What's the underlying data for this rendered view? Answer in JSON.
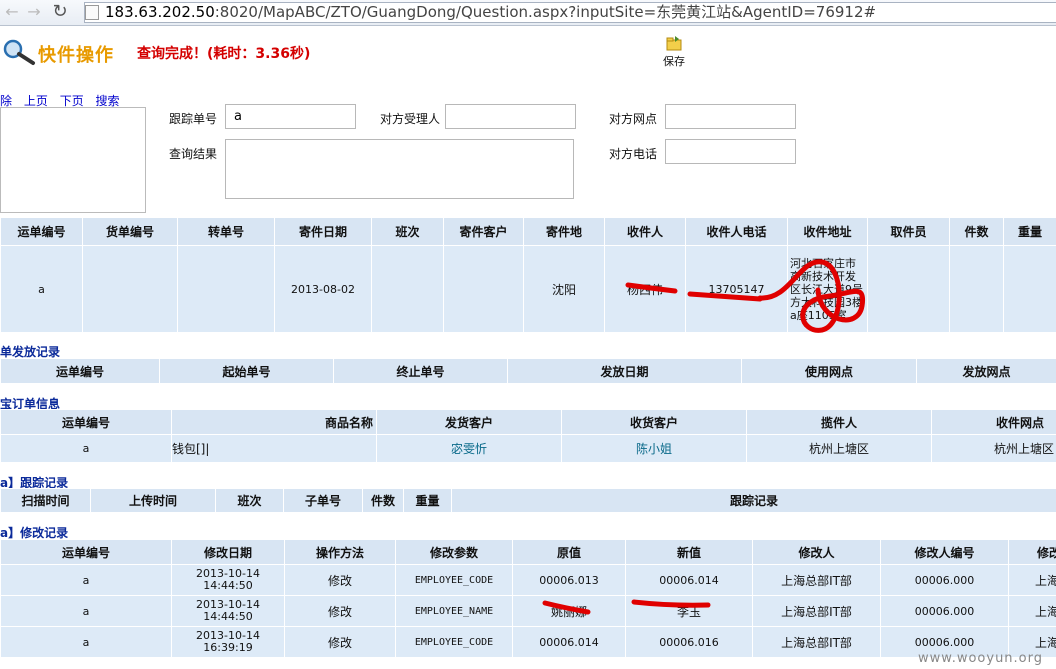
{
  "browser": {
    "url_host": "183.63.202.50",
    "url_path": ":8020/MapABC/ZTO/GuangDong/Question.aspx?inputSite=东莞黄江站&AgentID=76912#"
  },
  "header": {
    "title": "快件操作",
    "status": "查询完成！(耗时：3.36秒)",
    "save_label": "保存"
  },
  "toolbar": {
    "links": [
      "除",
      "上页",
      "下页",
      "搜索"
    ]
  },
  "form": {
    "tracking_no_label": "跟踪单号",
    "tracking_no_value": "a",
    "other_handler_label": "对方受理人",
    "other_site_label": "对方网点",
    "result_label": "查询结果",
    "other_phone_label": "对方电话"
  },
  "waybill_table": {
    "headers": [
      "运单编号",
      "货单编号",
      "转单号",
      "寄件日期",
      "班次",
      "寄件客户",
      "寄件地",
      "收件人",
      "收件人电话",
      "收件地址",
      "取件员",
      "件数",
      "重量"
    ],
    "rows": [
      [
        "a",
        "",
        "",
        "2013-08-02",
        "",
        "",
        "沈阳",
        "杨西伟",
        "13705147",
        "河北石家庄市高新技术开发区长江大道9号方大科技园3楼a座1105室",
        "",
        "",
        ""
      ]
    ]
  },
  "dispatch_section": {
    "title": "单发放记录",
    "headers": [
      "运单编号",
      "起始单号",
      "终止单号",
      "发放日期",
      "使用网点",
      "发放网点"
    ]
  },
  "order_section": {
    "title": "宝订单信息",
    "headers": [
      "运单编号",
      "商品名称",
      "发货客户",
      "收货客户",
      "揽件人",
      "收件网点"
    ],
    "rows": [
      [
        "a",
        "钱包[]|",
        "宓雯忻",
        "陈小姐",
        "杭州上塘区",
        "杭州上塘区"
      ]
    ]
  },
  "tracking_section": {
    "title": "a】跟踪记录",
    "headers": [
      "扫描时间",
      "上传时间",
      "班次",
      "子单号",
      "件数",
      "重量",
      "跟踪记录"
    ]
  },
  "modify_section": {
    "title": "a】修改记录",
    "headers": [
      "运单编号",
      "修改日期",
      "操作方法",
      "修改参数",
      "原值",
      "新值",
      "修改人",
      "修改人编号",
      "修改"
    ],
    "rows": [
      [
        "a",
        "2013-10-14",
        "14:44:50",
        "修改",
        "EMPLOYEE_CODE",
        "00006.013",
        "00006.014",
        "上海总部IT部",
        "00006.000",
        "上海"
      ],
      [
        "a",
        "2013-10-14",
        "14:44:50",
        "修改",
        "EMPLOYEE_NAME",
        "姚丽娜",
        "李玉",
        "上海总部IT部",
        "00006.000",
        "上海"
      ],
      [
        "a",
        "2013-10-14",
        "16:39:19",
        "修改",
        "EMPLOYEE_CODE",
        "00006.014",
        "00006.016",
        "上海总部IT部",
        "00006.000",
        "上海"
      ]
    ]
  },
  "watermark": "www.wooyun.org"
}
